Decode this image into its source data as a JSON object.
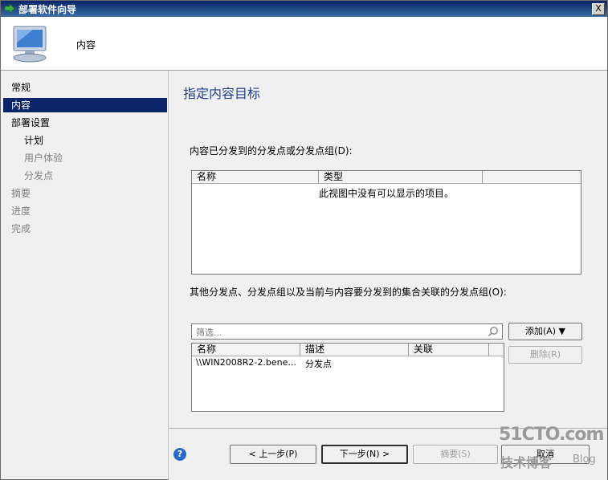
{
  "window": {
    "title": "部署软件向导",
    "close_label": "X"
  },
  "header": {
    "title": "内容"
  },
  "nav": {
    "items": [
      {
        "label": "常规",
        "state": "normal",
        "sub": false
      },
      {
        "label": "内容",
        "state": "active",
        "sub": false
      },
      {
        "label": "部署设置",
        "state": "normal",
        "sub": false
      },
      {
        "label": "计划",
        "state": "normal",
        "sub": true
      },
      {
        "label": "用户体验",
        "state": "disabled",
        "sub": true
      },
      {
        "label": "分发点",
        "state": "disabled",
        "sub": true
      },
      {
        "label": "摘要",
        "state": "disabled",
        "sub": false
      },
      {
        "label": "进度",
        "state": "disabled",
        "sub": false
      },
      {
        "label": "完成",
        "state": "disabled",
        "sub": false
      }
    ]
  },
  "main": {
    "page_title": "指定内容目标",
    "dist_label": "内容已分发到的分发点或分发点组(D):",
    "dist_list": {
      "columns": [
        "名称",
        "类型",
        ""
      ],
      "empty_text": "此视图中没有可以显示的项目。"
    },
    "other_label": "其他分发点、分发点组以及当前与内容要分发到的集合关联的分发点组(O):",
    "filter_placeholder": "筛选...",
    "add_button": "添加(A)  ▼",
    "remove_button": "删除(R)",
    "other_list": {
      "columns": [
        "名称",
        "描述",
        "关联"
      ],
      "rows": [
        {
          "name": "\\\\WIN2008R2-2.bene...",
          "desc": "分发点",
          "assoc": ""
        }
      ]
    }
  },
  "footer": {
    "prev_button": "< 上一步(P)",
    "next_button": "下一步(N) >",
    "summary_button": "摘要(S)",
    "cancel_button": "取消",
    "help_icon_text": "?"
  },
  "watermark": {
    "line1": "51CTO.com",
    "line2": "技术博客",
    "line3": "Blog"
  },
  "colors": {
    "title_bar": "#0a246a",
    "active_nav": "#0a246a",
    "page_title": "#1f3f8f"
  }
}
